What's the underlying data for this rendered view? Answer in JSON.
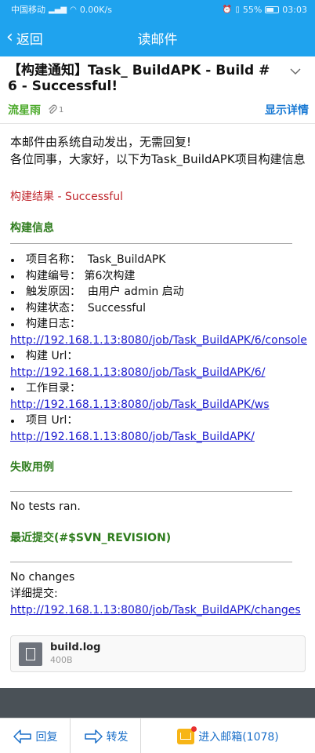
{
  "status_bar": {
    "carrier": "中国移动",
    "net_speed": "0.00K/s",
    "battery": "55%",
    "time": "03:03"
  },
  "nav": {
    "back_label": "返回",
    "title": "读邮件"
  },
  "mail": {
    "subject": "【构建通知】Task_ BuildAPK - Build # 6 - Successful!",
    "sender": "流星雨",
    "attachment_count": "1",
    "show_details": "显示详情"
  },
  "body": {
    "intro1": "本邮件由系统自动发出，无需回复!",
    "intro2": "各位同事，大家好，以下为Task_BuildAPK项目构建信息",
    "result": "构建结果 - Successful",
    "section_build_info": "构建信息",
    "items": [
      {
        "label": "项目名称：",
        "value": "Task_BuildAPK"
      },
      {
        "label": "构建编号：",
        "value": "第6次构建"
      },
      {
        "label": "触发原因：",
        "value": "由用户 admin 启动"
      },
      {
        "label": "构建状态：",
        "value": "Successful"
      },
      {
        "label": "构建日志：",
        "value": ""
      },
      {
        "label": "构建 Url：",
        "value": ""
      },
      {
        "label": "工作目录：",
        "value": ""
      },
      {
        "label": "项目 Url：",
        "value": ""
      }
    ],
    "links": {
      "console": "http://192.168.1.13:8080/job/Task_BuildAPK/6/console",
      "build_url": "http://192.168.1.13:8080/job/Task_BuildAPK/6/",
      "workspace": "http://192.168.1.13:8080/job/Task_BuildAPK/ws",
      "project_url": "http://192.168.1.13:8080/job/Task_BuildAPK/",
      "changes": "http://192.168.1.13:8080/job/Task_BuildAPK/changes"
    },
    "section_failed": "失败用例",
    "no_tests": "No tests ran.",
    "section_recent": "最近提交(#$SVN_REVISION)",
    "no_changes": "No changes",
    "details_label": "详细提交:"
  },
  "attachment": {
    "name": "build.log",
    "size": "400B"
  },
  "toolbar": {
    "reply": "回复",
    "forward": "转发",
    "inbox": "进入邮箱(1078)"
  }
}
